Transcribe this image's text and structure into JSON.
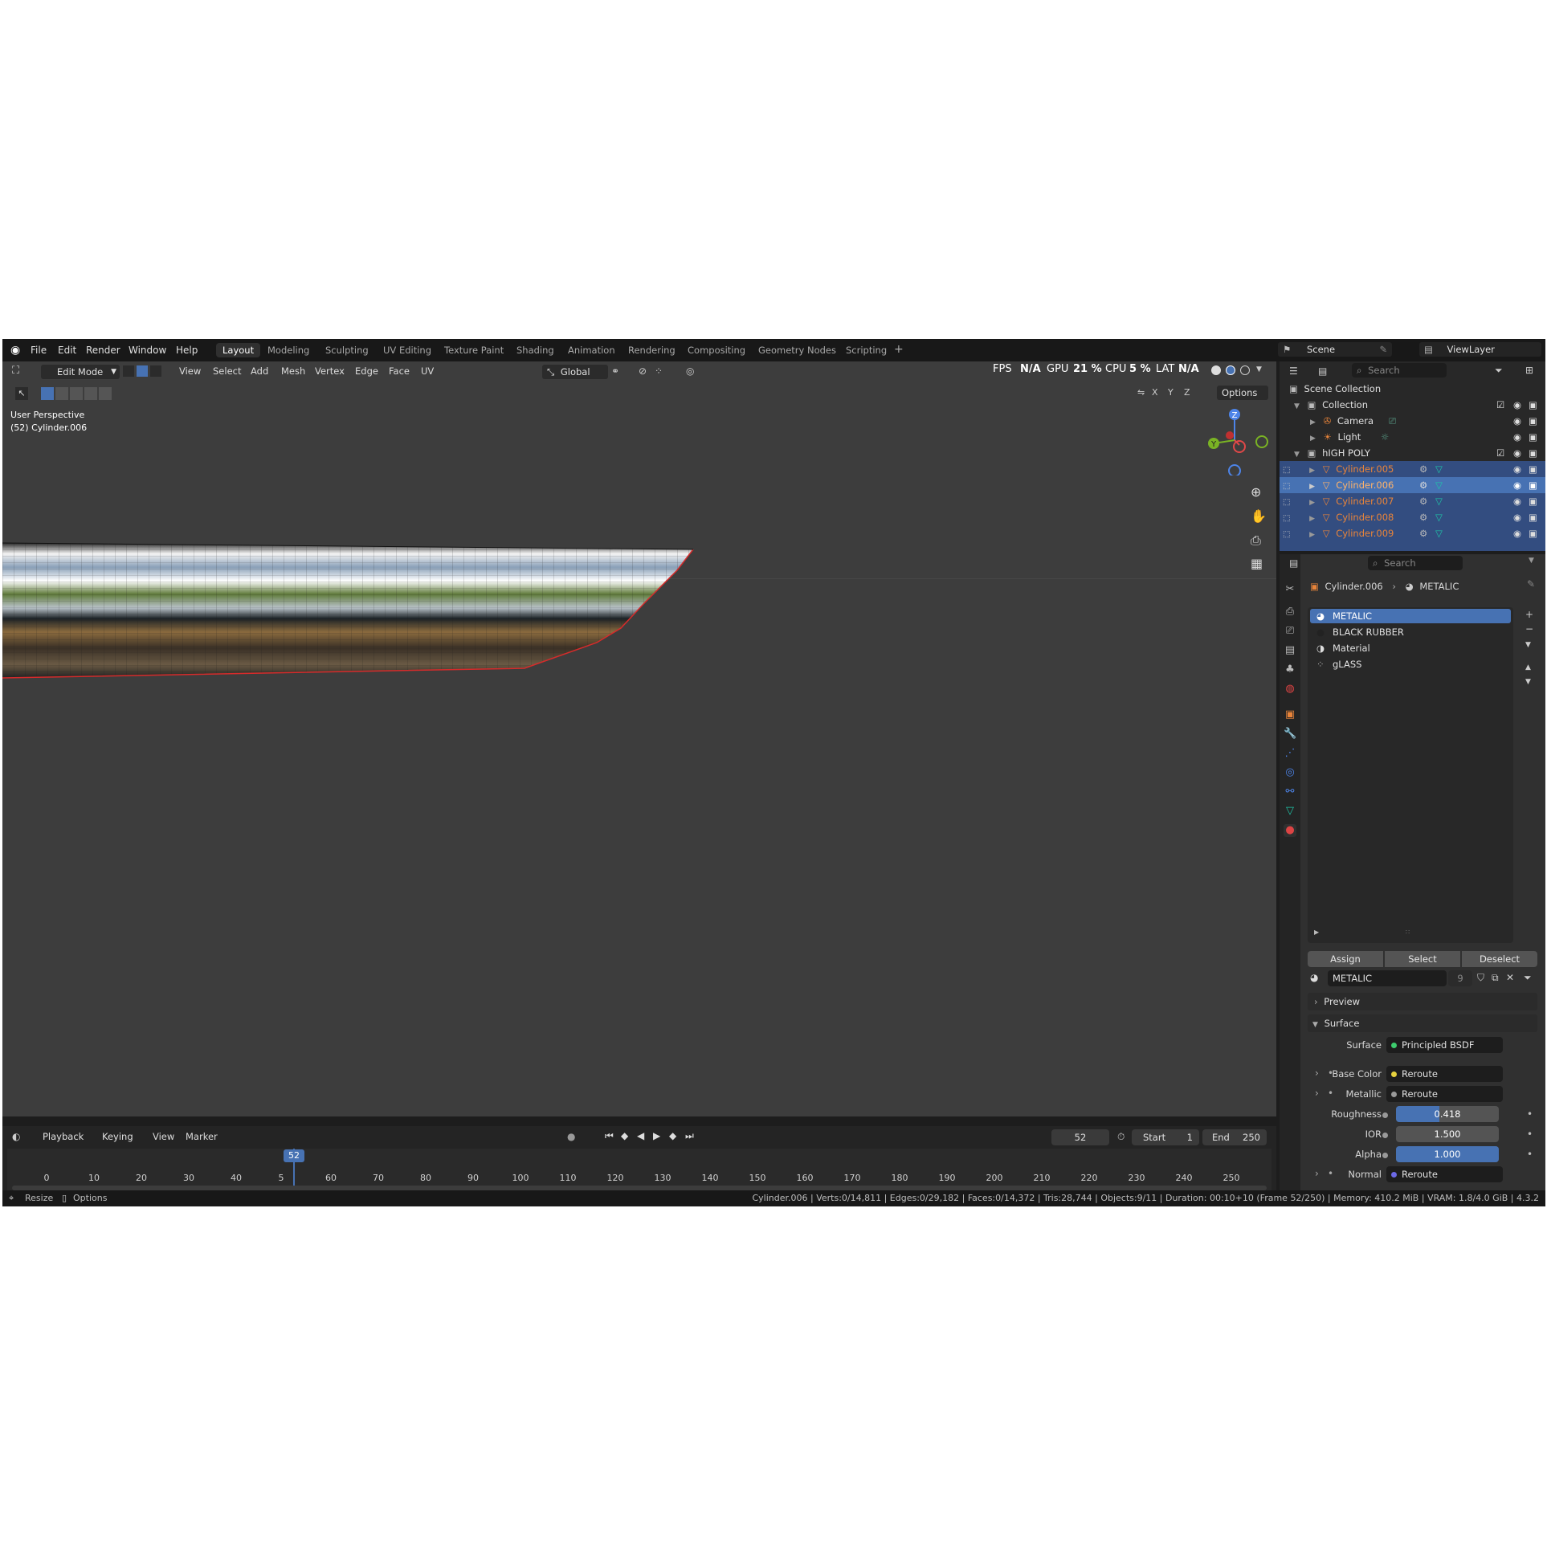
{
  "menu": {
    "file": "File",
    "edit": "Edit",
    "render": "Render",
    "window": "Window",
    "help": "Help"
  },
  "workspaces": [
    "Layout",
    "Modeling",
    "Sculpting",
    "UV Editing",
    "Texture Paint",
    "Shading",
    "Animation",
    "Rendering",
    "Compositing",
    "Geometry Nodes",
    "Scripting"
  ],
  "scene": {
    "name": "Scene",
    "view_layer": "ViewLayer"
  },
  "viewport": {
    "mode": "Edit Mode",
    "view": "View",
    "select": "Select",
    "add": "Add",
    "mesh": "Mesh",
    "vertex": "Vertex",
    "edge": "Edge",
    "face": "Face",
    "uv": "UV",
    "orientation": "Global",
    "options": "Options",
    "perspective": "User Perspective",
    "object": "(52) Cylinder.006",
    "stats": {
      "fps": "FPS",
      "fps_val": "N/A",
      "gpu": "GPU",
      "gpu_val": "21 %",
      "cpu": "CPU",
      "cpu_val": "5 %",
      "lat": "LAT",
      "lat_val": "N/A"
    },
    "axes": {
      "x": "X",
      "y": "Y",
      "z": "Z"
    }
  },
  "outliner": {
    "search_placeholder": "Search",
    "rows": [
      {
        "label": "Scene Collection"
      },
      {
        "label": "Collection"
      },
      {
        "label": "Camera"
      },
      {
        "label": "Light"
      },
      {
        "label": "hIGH POLY"
      },
      {
        "label": "Cylinder.005"
      },
      {
        "label": "Cylinder.006"
      },
      {
        "label": "Cylinder.007"
      },
      {
        "label": "Cylinder.008"
      },
      {
        "label": "Cylinder.009"
      }
    ]
  },
  "properties": {
    "search_placeholder": "Search",
    "breadcrumb_object": "Cylinder.006",
    "breadcrumb_material": "METALIC",
    "materials": [
      "METALIC",
      "BLACK RUBBER",
      "Material",
      "gLASS"
    ],
    "assign": "Assign",
    "select": "Select",
    "deselect": "Deselect",
    "material_name": "METALIC",
    "users": "9",
    "preview": "Preview",
    "surface_section": "Surface",
    "surface_label": "Surface",
    "surface_value": "Principled BSDF",
    "inputs": [
      {
        "label": "Base Color",
        "value": "Reroute"
      },
      {
        "label": "Metallic",
        "value": "Reroute"
      },
      {
        "label": "Roughness",
        "value": "0.418"
      },
      {
        "label": "IOR",
        "value": "1.500"
      },
      {
        "label": "Alpha",
        "value": "1.000"
      },
      {
        "label": "Normal",
        "value": "Reroute"
      }
    ],
    "roughness_fraction": 0.418,
    "alpha_fraction": 1.0
  },
  "timeline": {
    "playback": "Playback",
    "keying": "Keying",
    "view": "View",
    "marker": "Marker",
    "current": "52",
    "start_label": "Start",
    "start": "1",
    "end_label": "End",
    "end": "250",
    "ticks": [
      "0",
      "10",
      "20",
      "30",
      "40",
      "5",
      "60",
      "70",
      "80",
      "90",
      "100",
      "110",
      "120",
      "130",
      "140",
      "150",
      "160",
      "170",
      "180",
      "190",
      "200",
      "210",
      "220",
      "230",
      "240",
      "250"
    ]
  },
  "status": {
    "resize": "Resize",
    "options": "Options",
    "info": "Cylinder.006 | Verts:0/14,811 | Edges:0/29,182 | Faces:0/14,372 | Tris:28,744 | Objects:9/11 | Duration: 00:10+10 (Frame 52/250) | Memory: 410.2 MiB | VRAM: 1.8/4.0 GiB | 4.3.2"
  },
  "colors": {
    "accent": "#4772b3",
    "selection_orange": "#e8843a",
    "viewport_bg": "#3d3d3d",
    "header_bg": "#181818"
  }
}
